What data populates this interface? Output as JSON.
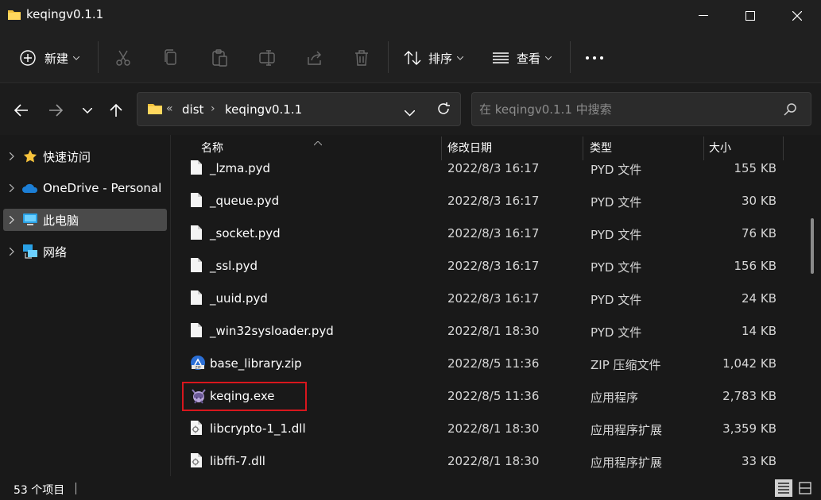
{
  "window": {
    "title": "keqingv0.1.1"
  },
  "toolbar": {
    "new_label": "新建",
    "sort_label": "排序",
    "view_label": "查看"
  },
  "address": {
    "overflow": "«",
    "crumbs": [
      "dist",
      "keqingv0.1.1"
    ]
  },
  "search": {
    "placeholder": "在 keqingv0.1.1 中搜索"
  },
  "sidebar": {
    "items": [
      {
        "label": "快速访问",
        "icon": "star-icon"
      },
      {
        "label": "OneDrive - Personal",
        "icon": "cloud-icon"
      },
      {
        "label": "此电脑",
        "icon": "computer-icon",
        "selected": true
      },
      {
        "label": "网络",
        "icon": "network-icon"
      }
    ]
  },
  "columns": {
    "name": "名称",
    "date": "修改日期",
    "type": "类型",
    "size": "大小"
  },
  "files": [
    {
      "name": "_lzma.pyd",
      "date": "2022/8/3 16:17",
      "type": "PYD 文件",
      "size": "155 KB",
      "icon": "file-icon"
    },
    {
      "name": "_queue.pyd",
      "date": "2022/8/3 16:17",
      "type": "PYD 文件",
      "size": "30 KB",
      "icon": "file-icon"
    },
    {
      "name": "_socket.pyd",
      "date": "2022/8/3 16:17",
      "type": "PYD 文件",
      "size": "76 KB",
      "icon": "file-icon"
    },
    {
      "name": "_ssl.pyd",
      "date": "2022/8/3 16:17",
      "type": "PYD 文件",
      "size": "156 KB",
      "icon": "file-icon"
    },
    {
      "name": "_uuid.pyd",
      "date": "2022/8/3 16:17",
      "type": "PYD 文件",
      "size": "24 KB",
      "icon": "file-icon"
    },
    {
      "name": "_win32sysloader.pyd",
      "date": "2022/8/1 18:30",
      "type": "PYD 文件",
      "size": "14 KB",
      "icon": "file-icon"
    },
    {
      "name": "base_library.zip",
      "date": "2022/8/5 11:36",
      "type": "ZIP 压缩文件",
      "size": "1,042 KB",
      "icon": "zip-icon"
    },
    {
      "name": "keqing.exe",
      "date": "2022/8/5 11:36",
      "type": "应用程序",
      "size": "2,783 KB",
      "icon": "app-icon",
      "highlighted": true
    },
    {
      "name": "libcrypto-1_1.dll",
      "date": "2022/8/1 18:30",
      "type": "应用程序扩展",
      "size": "3,359 KB",
      "icon": "dll-icon"
    },
    {
      "name": "libffi-7.dll",
      "date": "2022/8/1 18:30",
      "type": "应用程序扩展",
      "size": "33 KB",
      "icon": "dll-icon"
    }
  ],
  "status": {
    "item_count": "53 个项目"
  },
  "colors": {
    "highlight": "#d8161d",
    "folder": "#f2c13c",
    "selection": "#4a4a4a"
  }
}
